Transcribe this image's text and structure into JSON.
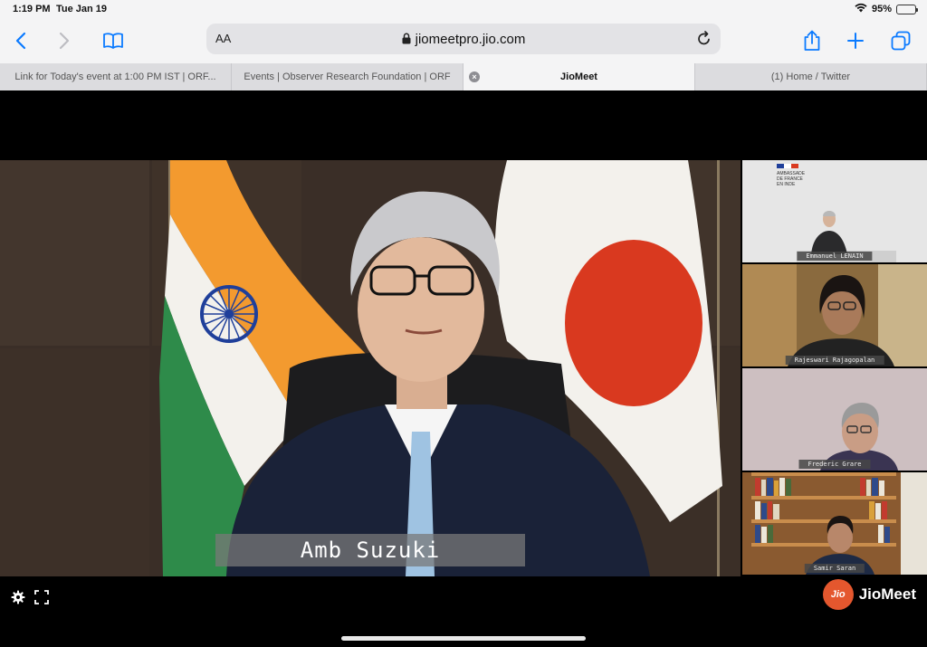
{
  "status_bar": {
    "time": "1:19 PM",
    "date": "Tue Jan 19",
    "battery_text": "95%",
    "battery_level": 0.95
  },
  "toolbar": {
    "text_size_label": "AA",
    "url": "jiomeetpro.jio.com",
    "icons": [
      "back-icon",
      "forward-icon",
      "bookmarks-icon",
      "lock-icon",
      "reload-icon",
      "share-icon",
      "plus-icon",
      "tabs-icon"
    ]
  },
  "tabs": [
    {
      "label": "Link for Today's event at 1:00 PM IST | ORF..."
    },
    {
      "label": "Events | Observer Research Foundation | ORF"
    },
    {
      "label": "JioMeet",
      "active": true
    },
    {
      "label": "(1) Home / Twitter"
    }
  ],
  "meeting": {
    "speaker_name": "Amb Suzuki",
    "participants": [
      {
        "name": "Emmanuel LENAIN",
        "backdrop_text": [
          "AMBASSADE",
          "DE FRANCE",
          "EN INDE"
        ]
      },
      {
        "name": "Rajeswari Rajagopalan"
      },
      {
        "name": "Frederic Grare"
      },
      {
        "name": "Samir Saran"
      }
    ],
    "brand": {
      "logo_text": "Jio",
      "name": "JioMeet"
    }
  },
  "colors": {
    "browser_chrome": "#f4f4f5",
    "ios_blue": "#0a7aff",
    "brand_orange": "#e4572e",
    "india_saffron": "#f39a2f",
    "india_green": "#2e8b4a",
    "india_chakra": "#1f3f9a",
    "japan_red": "#d9391f"
  }
}
